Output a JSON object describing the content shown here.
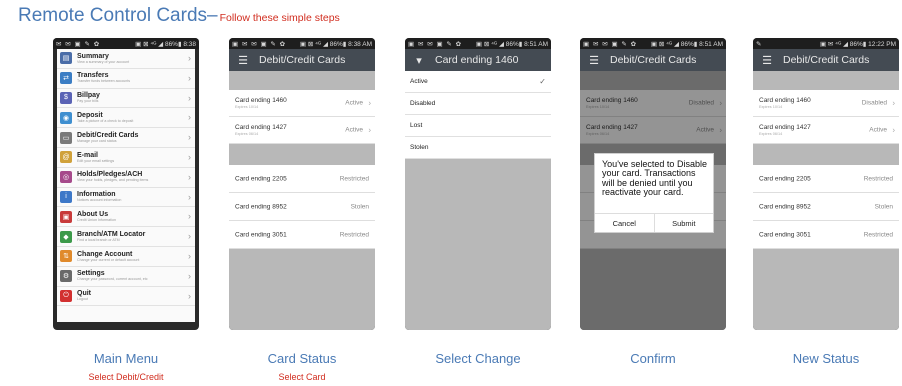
{
  "title": {
    "main": "Remote Control Cards–",
    "sub": "Follow these simple steps"
  },
  "colors": {
    "accent": "#4a7ab5",
    "red": "#d12d1f",
    "appbar": "#444b53"
  },
  "phones": [
    {
      "status_left": "✉ ✉ ▣ ✎ ✿",
      "status_right": "▣ ⊠ ⁴ᴳ ◢ 86%▮ 8:38",
      "menu": [
        {
          "label": "Summary",
          "desc": "View a summary of your account",
          "icon": "summary-icon",
          "color": "#4a6da8",
          "glyph": "▤"
        },
        {
          "label": "Transfers",
          "desc": "Transfer funds between accounts",
          "icon": "transfers-icon",
          "color": "#3b7dc4",
          "glyph": "⇄"
        },
        {
          "label": "Billpay",
          "desc": "Pay your bills",
          "icon": "billpay-icon",
          "color": "#5a63b5",
          "glyph": "$"
        },
        {
          "label": "Deposit",
          "desc": "Take a picture of a check to deposit",
          "icon": "deposit-icon",
          "color": "#3f8fd0",
          "glyph": "◉"
        },
        {
          "label": "Debit/Credit Cards",
          "desc": "Manage your card status",
          "icon": "cards-icon",
          "color": "#7a7a7a",
          "glyph": "▭"
        },
        {
          "label": "E-mail",
          "desc": "Edit your email settings",
          "icon": "email-icon",
          "color": "#d0a13a",
          "glyph": "@"
        },
        {
          "label": "Holds/Pledges/ACH",
          "desc": "View your holds, pledges, and pending items",
          "icon": "holds-icon",
          "color": "#a64a8b",
          "glyph": "◎"
        },
        {
          "label": "Information",
          "desc": "Notices account information",
          "icon": "information-icon",
          "color": "#3d78c8",
          "glyph": "i"
        },
        {
          "label": "About Us",
          "desc": "Credit Union Information",
          "icon": "about-icon",
          "color": "#c83a3a",
          "glyph": "▣"
        },
        {
          "label": "Branch/ATM Locator",
          "desc": "Find a local branch or ATM",
          "icon": "locator-icon",
          "color": "#3c9a4a",
          "glyph": "◆"
        },
        {
          "label": "Change Account",
          "desc": "Change your current or default account",
          "icon": "change-account-icon",
          "color": "#e08a2c",
          "glyph": "⇅"
        },
        {
          "label": "Settings",
          "desc": "Change your password, current account, etc",
          "icon": "settings-icon",
          "color": "#6a6a6a",
          "glyph": "⚙"
        },
        {
          "label": "Quit",
          "desc": "Logout",
          "icon": "quit-icon",
          "color": "#d23030",
          "glyph": "⏻"
        }
      ],
      "caption": "Main Menu",
      "subcaption": "Select Debit/Credit"
    },
    {
      "status_left": "▣ ✉ ✉ ▣ ✎ ✿",
      "status_right": "▣ ⊠ ⁴ᴳ ◢ 86%▮ 8:38 AM",
      "app_title": "Debit/Credit Cards",
      "cards": [
        {
          "name": "Card ending 1460",
          "expires": "Expires 10/14",
          "status": "Active"
        },
        {
          "name": "Card ending 1427",
          "expires": "Expires 06/14",
          "status": "Active"
        },
        {
          "name": "Card ending 2205",
          "status": "Restricted"
        },
        {
          "name": "Card ending 8952",
          "status": "Stolen"
        },
        {
          "name": "Card ending 3051",
          "status": "Restricted"
        }
      ],
      "caption": "Card Status",
      "subcaption": "Select Card"
    },
    {
      "status_left": "▣ ✉ ✉ ▣ ✎ ✿",
      "status_right": "▣ ⊠ ⁴ᴳ ◢ 86%▮ 8:51 AM",
      "app_title": "Card ending 1460",
      "options": [
        "Active",
        "Disabled",
        "Lost",
        "Stolen"
      ],
      "caption": "Select Change"
    },
    {
      "status_left": "▣ ✉ ✉ ▣ ✎ ✿",
      "status_right": "▣ ⊠ ⁴ᴳ ◢ 86%▮ 8:51 AM",
      "app_title": "Debit/Credit Cards",
      "cards": [
        {
          "name": "Card ending 1460",
          "expires": "Expires 10/14",
          "status": "Disabled"
        },
        {
          "name": "Card ending 1427",
          "expires": "Expires 06/14",
          "status": "Active"
        }
      ],
      "dialog": {
        "message": "You've selected to Disable your card. Transactions will be denied until you reactivate your card.",
        "cancel": "Cancel",
        "submit": "Submit"
      },
      "caption": "Confirm"
    },
    {
      "status_left": "✎",
      "status_right": "▣ ✉ ⁴ᴳ ◢ 86%▮ 12:22 PM",
      "app_title": "Debit/Credit Cards",
      "cards": [
        {
          "name": "Card ending 1460",
          "expires": "Expires 10/14",
          "status": "Disabled"
        },
        {
          "name": "Card ending 1427",
          "expires": "Expires 06/14",
          "status": "Active"
        },
        {
          "name": "Card ending 2205",
          "status": "Restricted"
        },
        {
          "name": "Card ending 8952",
          "status": "Stolen"
        },
        {
          "name": "Card ending 3051",
          "status": "Restricted"
        }
      ],
      "caption": "New Status"
    }
  ]
}
